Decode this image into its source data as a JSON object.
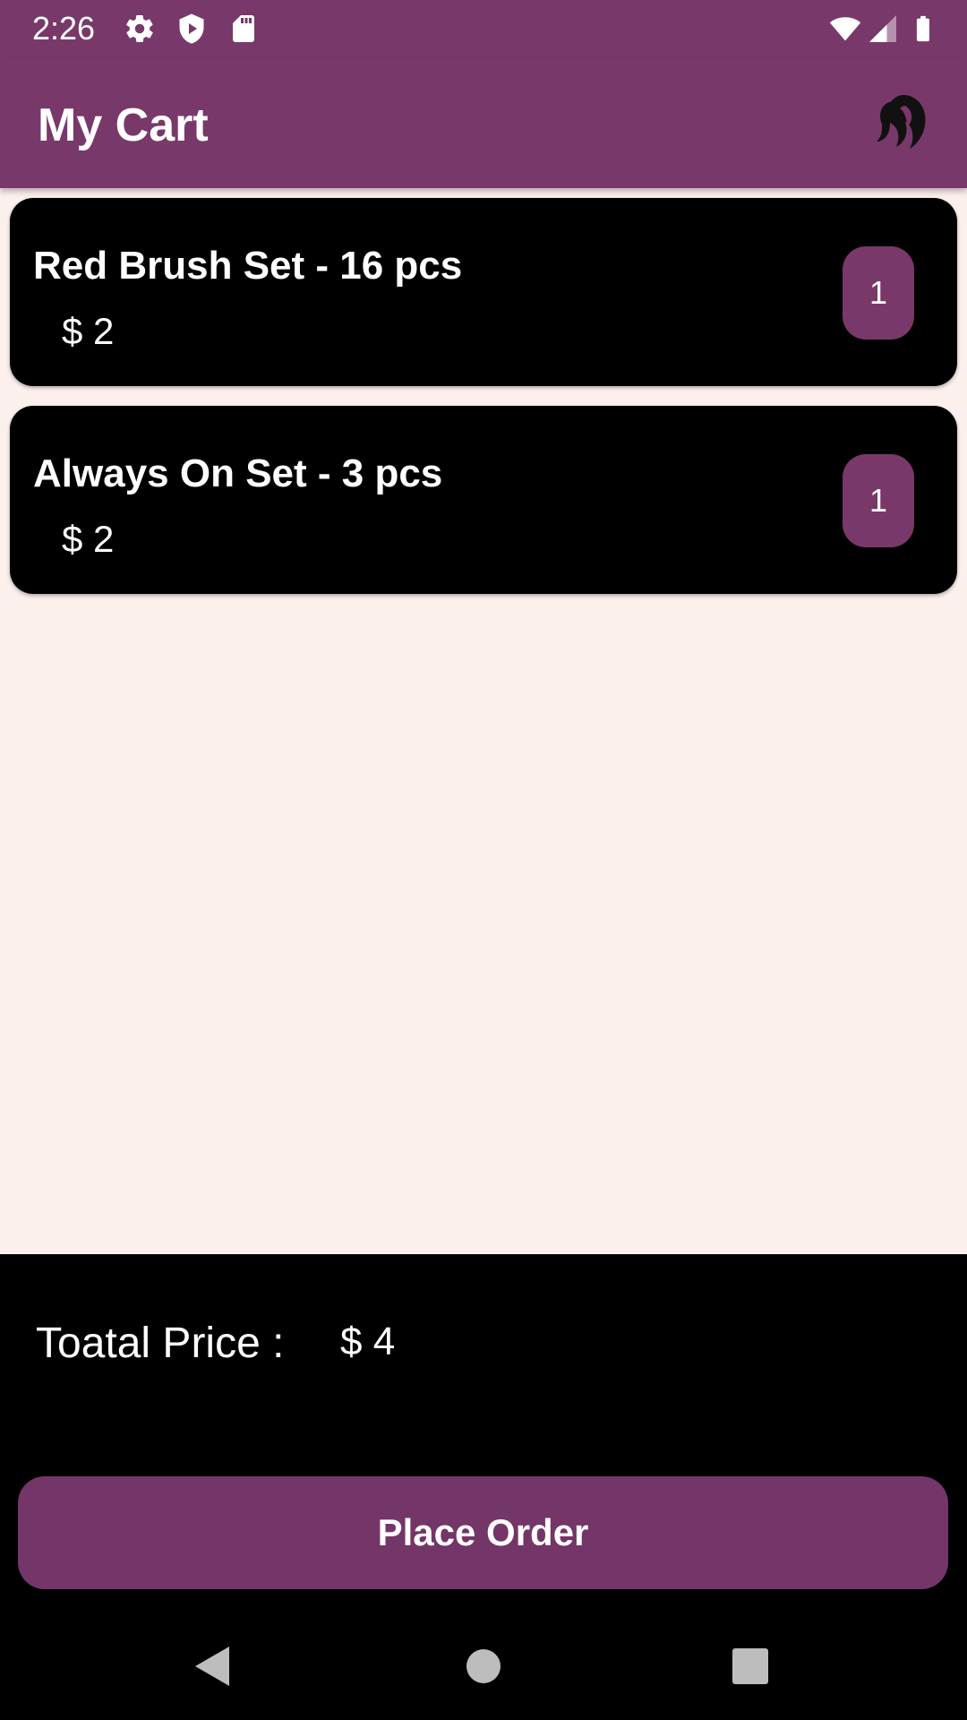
{
  "status_bar": {
    "time": "2:26",
    "icons": [
      "gear-icon",
      "shield-play-icon",
      "sd-card-icon",
      "wifi-icon",
      "signal-icon",
      "battery-icon"
    ]
  },
  "app_bar": {
    "title": "My Cart",
    "logo_icon": "hair-silhouette-logo-icon",
    "background_color": "#79386A"
  },
  "cart": {
    "items": [
      {
        "name": "Red Brush Set - 16 pcs",
        "price": "$ 2",
        "quantity": "1"
      },
      {
        "name": "Always On Set - 3 pcs",
        "price": "$ 2",
        "quantity": "1"
      }
    ]
  },
  "summary": {
    "total_label": "Toatal Price :",
    "total_value": "$ 4",
    "place_order_label": "Place Order"
  },
  "nav_bar": {
    "icons": [
      "back-icon",
      "home-icon",
      "recents-icon"
    ]
  },
  "colors": {
    "accent": "#79386A",
    "page_background": "#FCF0EC",
    "card_background": "#000000"
  }
}
